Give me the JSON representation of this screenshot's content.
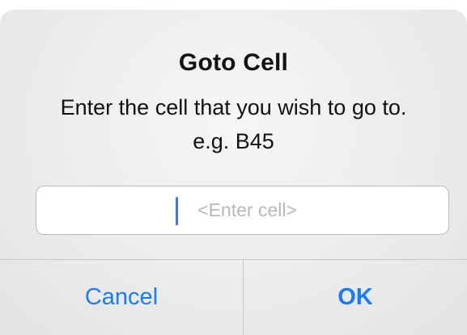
{
  "dialog": {
    "title": "Goto Cell",
    "message_line1": "Enter the cell that you wish to go to.",
    "message_line2": "e.g. B45",
    "input": {
      "value": "",
      "placeholder": "<Enter cell>"
    },
    "buttons": {
      "cancel_label": "Cancel",
      "ok_label": "OK"
    }
  },
  "colors": {
    "accent": "#1a7cf5",
    "caret": "#3d78f3",
    "placeholder": "#b7b7bd"
  }
}
